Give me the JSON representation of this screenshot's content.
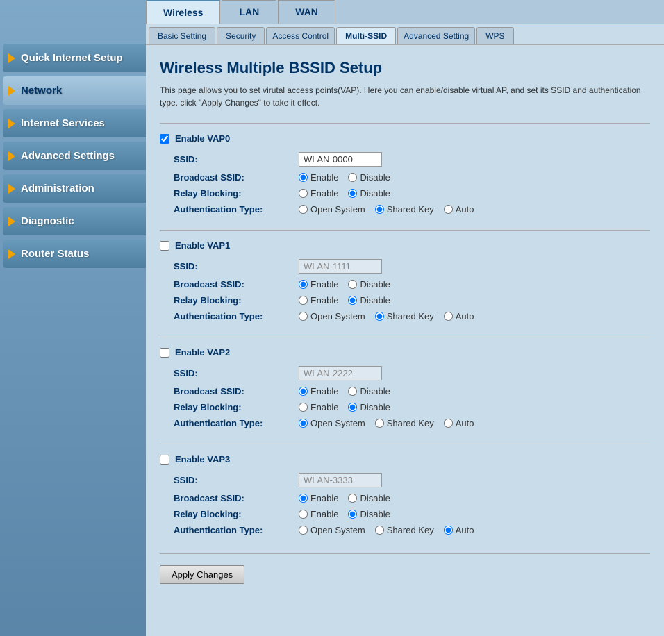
{
  "sidebar": {
    "items": [
      {
        "id": "quick-internet-setup",
        "label": "Quick Internet Setup",
        "active": false
      },
      {
        "id": "network",
        "label": "Network",
        "active": true
      },
      {
        "id": "internet-services",
        "label": "Internet Services",
        "active": false
      },
      {
        "id": "advanced-settings",
        "label": "Advanced Settings",
        "active": false
      },
      {
        "id": "administration",
        "label": "Administration",
        "active": false
      },
      {
        "id": "diagnostic",
        "label": "Diagnostic",
        "active": false
      },
      {
        "id": "router-status",
        "label": "Router Status",
        "active": false
      }
    ]
  },
  "top_tabs": [
    {
      "id": "wireless",
      "label": "Wireless",
      "active": true
    },
    {
      "id": "lan",
      "label": "LAN",
      "active": false
    },
    {
      "id": "wan",
      "label": "WAN",
      "active": false
    }
  ],
  "sub_tabs": [
    {
      "id": "basic-setting",
      "label": "Basic Setting",
      "active": false
    },
    {
      "id": "security",
      "label": "Security",
      "active": false
    },
    {
      "id": "access-control",
      "label": "Access Control",
      "active": false
    },
    {
      "id": "multi-ssid",
      "label": "Multi-SSID",
      "active": true
    },
    {
      "id": "advanced-setting",
      "label": "Advanced Setting",
      "active": false
    },
    {
      "id": "wps",
      "label": "WPS",
      "active": false
    }
  ],
  "page": {
    "title": "Wireless Multiple BSSID Setup",
    "description": "This page allows you to set virutal access points(VAP). Here you can enable/disable virtual AP, and set its SSID and authentication type. click \"Apply Changes\" to take it effect."
  },
  "vaps": [
    {
      "id": "vap0",
      "enable_label": "Enable VAP0",
      "enabled": true,
      "ssid_label": "SSID:",
      "ssid_value": "WLAN-0000",
      "broadcast_ssid_label": "Broadcast SSID:",
      "broadcast_enable": true,
      "relay_blocking_label": "Relay Blocking:",
      "relay_disable": true,
      "auth_type_label": "Authentication Type:",
      "auth_type": "shared-key",
      "disabled_fields": false
    },
    {
      "id": "vap1",
      "enable_label": "Enable VAP1",
      "enabled": false,
      "ssid_label": "SSID:",
      "ssid_value": "WLAN-1111",
      "broadcast_ssid_label": "Broadcast SSID:",
      "broadcast_enable": true,
      "relay_blocking_label": "Relay Blocking:",
      "relay_disable": true,
      "auth_type_label": "Authentication Type:",
      "auth_type": "shared-key",
      "disabled_fields": true
    },
    {
      "id": "vap2",
      "enable_label": "Enable VAP2",
      "enabled": false,
      "ssid_label": "SSID:",
      "ssid_value": "WLAN-2222",
      "broadcast_ssid_label": "Broadcast SSID:",
      "broadcast_enable": true,
      "relay_blocking_label": "Relay Blocking:",
      "relay_disable": true,
      "auth_type_label": "Authentication Type:",
      "auth_type": "open-system",
      "disabled_fields": true
    },
    {
      "id": "vap3",
      "enable_label": "Enable VAP3",
      "enabled": false,
      "ssid_label": "SSID:",
      "ssid_value": "WLAN-3333",
      "broadcast_ssid_label": "Broadcast SSID:",
      "broadcast_enable": true,
      "relay_blocking_label": "Relay Blocking:",
      "relay_disable": true,
      "auth_type_label": "Authentication Type:",
      "auth_type": "auto",
      "disabled_fields": true
    }
  ],
  "buttons": {
    "apply_changes": "Apply Changes"
  },
  "radio_labels": {
    "enable": "Enable",
    "disable": "Disable",
    "open_system": "Open System",
    "shared_key": "Shared Key",
    "auto": "Auto"
  }
}
